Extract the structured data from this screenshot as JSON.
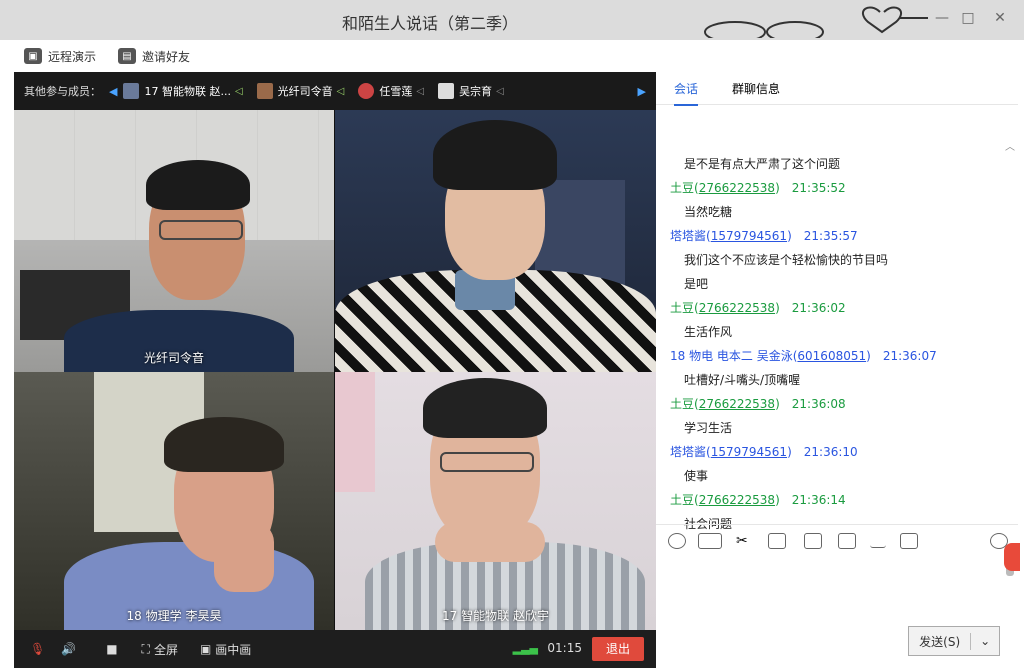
{
  "window": {
    "title": "和陌生人说话（第二季）"
  },
  "toolbar": {
    "remote_demo": "远程演示",
    "invite_friends": "邀请好友"
  },
  "member_bar": {
    "label": "其他参与成员：",
    "members": [
      {
        "name": "17 智能物联 赵..."
      },
      {
        "name": "光纤司令音"
      },
      {
        "name": "任雪莲"
      },
      {
        "name": "吴宗育"
      }
    ]
  },
  "tiles": [
    {
      "name": "光纤司令音"
    },
    {
      "name": ""
    },
    {
      "name": "18 物理学 李昊昊"
    },
    {
      "name": "17 智能物联 赵欣宇"
    }
  ],
  "video_controls": {
    "fullscreen": "全屏",
    "picture_in_picture": "画中画",
    "timer": "01:15",
    "leave": "退出"
  },
  "chat": {
    "tabs": [
      "会话",
      "群聊信息"
    ],
    "messages": [
      {
        "type": "text",
        "text": "是不是有点大严肃了这个问题"
      },
      {
        "type": "sender",
        "name": "土豆",
        "qq": "2766222538",
        "time": "21:35:52",
        "color": "green"
      },
      {
        "type": "text",
        "text": "当然吃糖"
      },
      {
        "type": "sender",
        "name": "塔塔酱",
        "qq": "1579794561",
        "time": "21:35:57",
        "color": "blue"
      },
      {
        "type": "text",
        "text": "我们这个不应该是个轻松愉快的节目吗"
      },
      {
        "type": "text",
        "text": "是吧"
      },
      {
        "type": "sender",
        "name": "土豆",
        "qq": "2766222538",
        "time": "21:36:02",
        "color": "green"
      },
      {
        "type": "text",
        "text": "生活作风"
      },
      {
        "type": "sender",
        "name": "18 物电 电本二 吴金泳",
        "qq": "601608051",
        "time": "21:36:07",
        "color": "blue"
      },
      {
        "type": "text",
        "text": "吐槽好/斗嘴头/顶嘴喔"
      },
      {
        "type": "sender",
        "name": "土豆",
        "qq": "2766222538",
        "time": "21:36:08",
        "color": "green"
      },
      {
        "type": "text",
        "text": "学习生活"
      },
      {
        "type": "sender",
        "name": "塔塔酱",
        "qq": "1579794561",
        "time": "21:36:10",
        "color": "blue"
      },
      {
        "type": "text",
        "text": "使事"
      },
      {
        "type": "sender",
        "name": "土豆",
        "qq": "2766222538",
        "time": "21:36:14",
        "color": "green"
      },
      {
        "type": "text",
        "text": "社会问题"
      }
    ],
    "send_button": "发送(S)"
  },
  "colors": {
    "accent": "#2a66d8",
    "leave": "#e04a3c",
    "sender_green": "#1a9b3f",
    "sender_blue": "#2a55e0"
  }
}
